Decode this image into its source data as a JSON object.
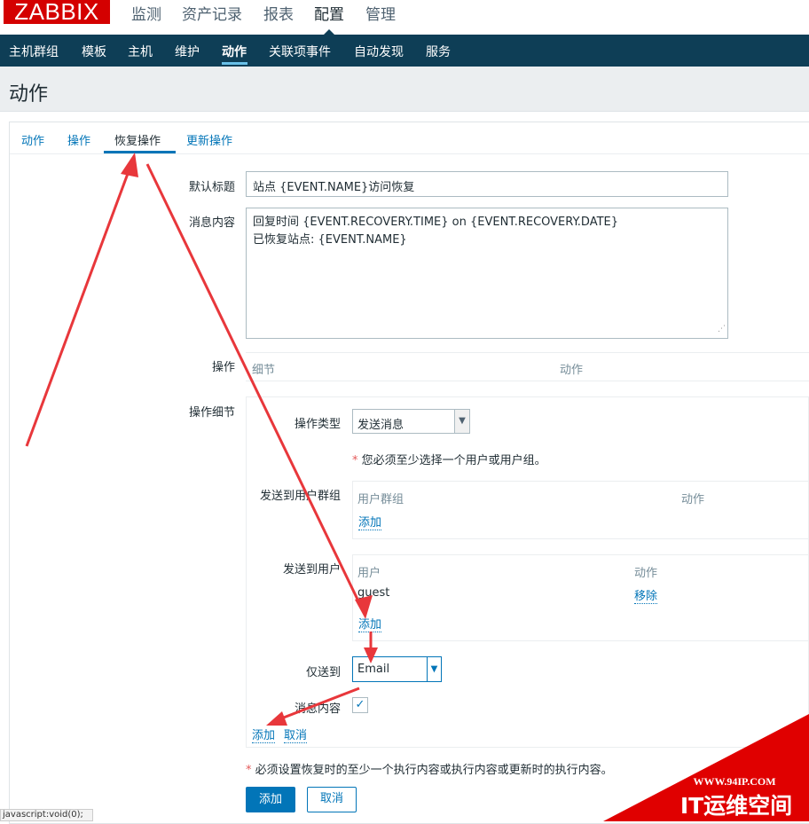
{
  "brand": {
    "logo_text": "ZABBIX",
    "logo_color": "#d40000"
  },
  "top_menu": [
    {
      "label": "监测"
    },
    {
      "label": "资产记录"
    },
    {
      "label": "报表"
    },
    {
      "label": "配置",
      "active": true
    },
    {
      "label": "管理"
    }
  ],
  "sub_menu": [
    {
      "label": "主机群组"
    },
    {
      "label": "模板"
    },
    {
      "label": "主机"
    },
    {
      "label": "维护"
    },
    {
      "label": "动作",
      "active": true
    },
    {
      "label": "关联项事件"
    },
    {
      "label": "自动发现"
    },
    {
      "label": "服务"
    }
  ],
  "page_title": "动作",
  "tabs": [
    {
      "label": "动作"
    },
    {
      "label": "操作"
    },
    {
      "label": "恢复操作",
      "active": true
    },
    {
      "label": "更新操作"
    }
  ],
  "form": {
    "default_subject_label": "默认标题",
    "default_subject_value": "站点 {EVENT.NAME}访问恢复",
    "message_label": "消息内容",
    "message_line1": "回复时间 {EVENT.RECOVERY.TIME} on {EVENT.RECOVERY.DATE}",
    "message_line2": "已恢复站点: {EVENT.NAME}",
    "operations_label": "操作",
    "operations_col_details": "细节",
    "operations_col_action": "动作",
    "op_details_label": "操作细节",
    "op_type_label": "操作类型",
    "op_type_value": "发送消息",
    "must_select_note": "您必须至少选择一个用户或用户组。",
    "send_to_groups_label": "发送到用户群组",
    "groups_col_group": "用户群组",
    "groups_col_action": "动作",
    "groups_add": "添加",
    "send_to_users_label": "发送到用户",
    "users_col_user": "用户",
    "users_col_action": "动作",
    "user_row_name": "guest",
    "user_row_remove": "移除",
    "users_add": "添加",
    "send_only_label": "仅送到",
    "send_only_value": "Email",
    "message_content_label": "消息内容",
    "message_content_checked": true,
    "op_add": "添加",
    "op_cancel": "取消",
    "bottom_note": "必须设置恢复时的至少一个执行内容或执行内容或更新时的执行内容。",
    "required_mark": "*",
    "submit_add": "添加",
    "submit_cancel": "取消"
  },
  "status_bar_text": "javascript:void(0);",
  "watermark": {
    "url": "WWW.94IP.COM",
    "name": "IT运维空间"
  },
  "colors": {
    "nav_bg": "#0e3e56",
    "link": "#0275b8",
    "arrow": "#e8373b"
  }
}
